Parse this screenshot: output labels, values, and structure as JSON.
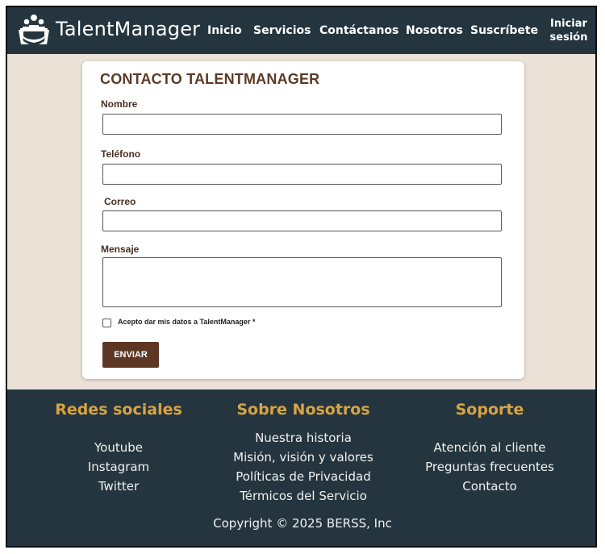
{
  "header": {
    "brand": "TalentManager",
    "logo_icon": "people-hands-icon",
    "nav": [
      {
        "label": "Inicio"
      },
      {
        "label": "Servicios"
      },
      {
        "label": "Contáctanos"
      },
      {
        "label": "Nosotros"
      },
      {
        "label": "Suscríbete"
      }
    ],
    "login_line1": "Iniciar",
    "login_line2": "sesión"
  },
  "form": {
    "title": "CONTACTO TALENTMANAGER",
    "fields": [
      {
        "label": "Nombre",
        "value": ""
      },
      {
        "label": "Teléfono",
        "value": ""
      },
      {
        "label": "Correo",
        "value": ""
      },
      {
        "label": "Mensaje",
        "value": ""
      }
    ],
    "consent_label": "Acepto dar mis datos a TalentManager *",
    "consent_checked": false,
    "submit_label": "ENVIAR"
  },
  "footer": {
    "columns": [
      {
        "heading": "Redes sociales",
        "links": [
          "Youtube",
          "Instagram",
          "Twitter"
        ]
      },
      {
        "heading": "Sobre Nosotros",
        "links": [
          "Nuestra historia",
          "Misión, visión y valores",
          "Políticas de Privacidad",
          "Térmicos del Servicio"
        ]
      },
      {
        "heading": "Soporte",
        "links": [
          "Atención al cliente",
          "Preguntas frecuentes",
          "Contacto"
        ]
      }
    ],
    "copyright": "Copyright © 2025 BERSS, Inc"
  },
  "colors": {
    "header_bg": "#24353f",
    "page_bg": "#ece2d8",
    "accent_brown": "#5e3724",
    "footer_heading": "#d9a441"
  }
}
